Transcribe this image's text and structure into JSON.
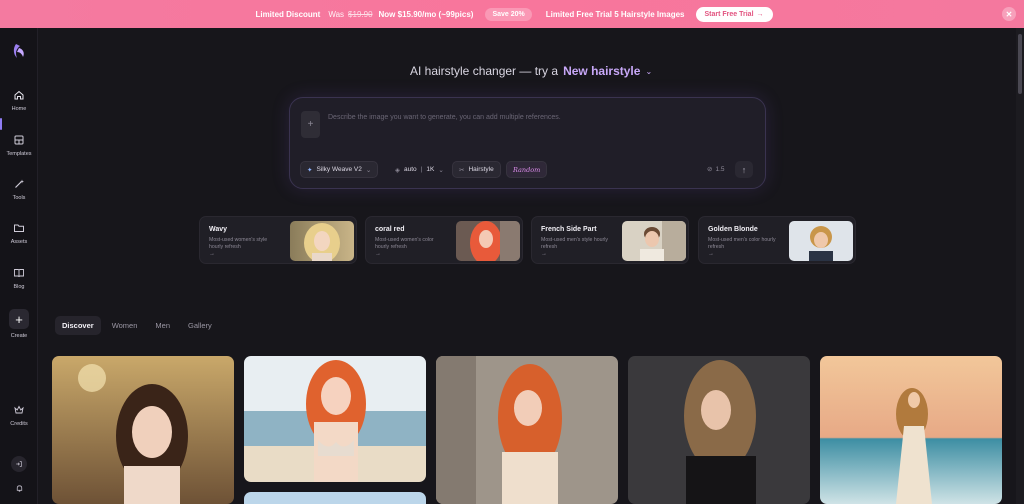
{
  "banner": {
    "label": "Limited Discount",
    "was_label": "Was",
    "was_price": "$19.90",
    "now": "Now $15.90/mo (~99pics)",
    "save_badge": "Save 20%",
    "trial_text": "Limited Free Trial 5 Hairstyle Images",
    "cta": "Start Free Trial",
    "cta_icon": "arrow-right-icon",
    "close_icon": "close-icon"
  },
  "sidebar": {
    "items": [
      {
        "label": "Home",
        "icon": "home-icon"
      },
      {
        "label": "Templates",
        "icon": "templates-icon"
      },
      {
        "label": "Tools",
        "icon": "magic-wand-icon"
      },
      {
        "label": "Assets",
        "icon": "folder-icon"
      },
      {
        "label": "Blog",
        "icon": "book-icon"
      },
      {
        "label": "Create",
        "icon": "plus-icon"
      }
    ],
    "credits_label": "Credits"
  },
  "hero": {
    "prefix": "AI hairstyle changer — try a",
    "accent": "New hairstyle"
  },
  "composer": {
    "placeholder": "Describe the image you want to generate, you can add multiple references.",
    "model": "Silky Weave V2",
    "ratio": "auto",
    "resolution": "1K",
    "hairstyle_btn": "Hairstyle",
    "random_btn": "Random",
    "credit_cost": "1.5"
  },
  "cards": [
    {
      "title": "Wavy",
      "desc": "Most-used women's style hourly refresh"
    },
    {
      "title": "coral red",
      "desc": "Most-used women's color hourly refresh"
    },
    {
      "title": "French Side Part",
      "desc": "Most-used men's style hourly refresh"
    },
    {
      "title": "Golden Blonde",
      "desc": "Most-used men's color hourly refresh"
    }
  ],
  "card_arrow": "→",
  "tabs": [
    "Discover",
    "Women",
    "Men",
    "Gallery"
  ],
  "colors": {
    "accent": "#c8a8f8",
    "banner": "#f47aa0",
    "background": "#17161b"
  }
}
